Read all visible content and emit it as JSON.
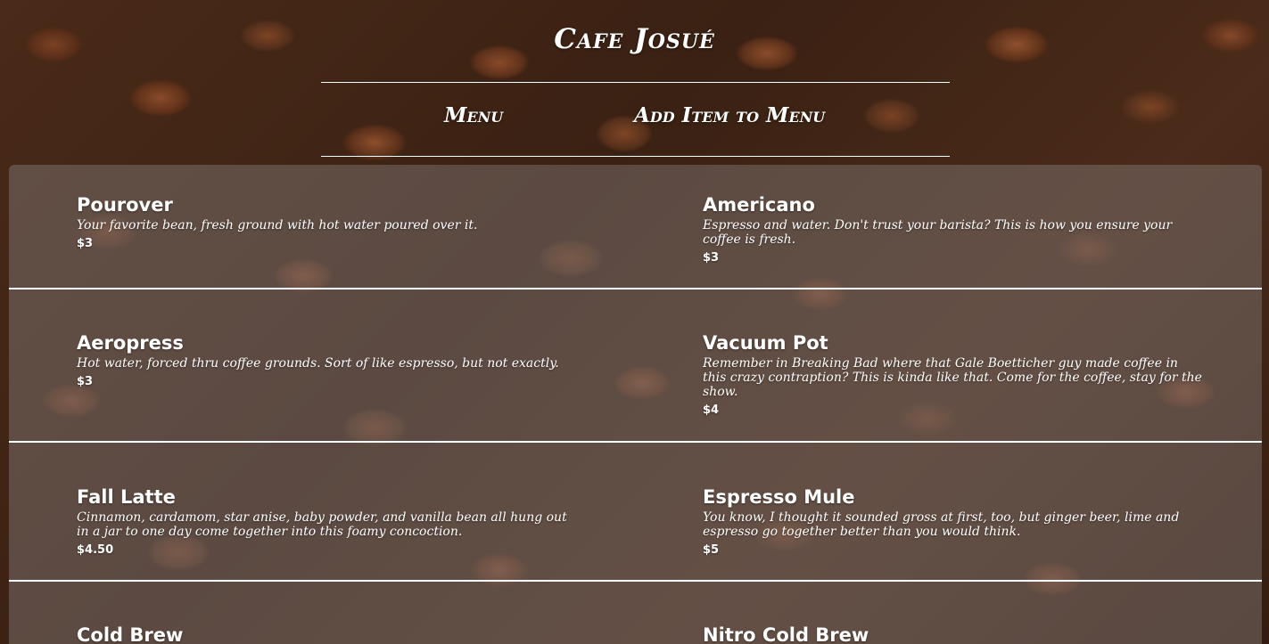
{
  "header": {
    "title": "Cafe Josué",
    "nav": {
      "menu": "Menu",
      "add_item": "Add Item to Menu"
    }
  },
  "menu": {
    "rows": [
      {
        "left": {
          "name": "Pourover",
          "description": "Your favorite bean, fresh ground with hot water poured over it.",
          "price": "$3"
        },
        "right": {
          "name": "Americano",
          "description": "Espresso and water. Don't trust your barista? This is how you ensure your coffee is fresh.",
          "price": "$3"
        }
      },
      {
        "left": {
          "name": "Aeropress",
          "description": "Hot water, forced thru coffee grounds. Sort of like espresso, but not exactly.",
          "price": "$3"
        },
        "right": {
          "name": "Vacuum Pot",
          "description": "Remember in Breaking Bad where that Gale Boetticher guy made coffee in this crazy contraption? This is kinda like that. Come for the coffee, stay for the show.",
          "price": "$4"
        }
      },
      {
        "left": {
          "name": "Fall Latte",
          "description": "Cinnamon, cardamom, star anise, baby powder, and vanilla bean all hung out in a jar to one day come together into this foamy concoction.",
          "price": "$4.50"
        },
        "right": {
          "name": "Espresso Mule",
          "description": "You know, I thought it sounded gross at first, too, but ginger beer, lime and espresso go together better than you would think.",
          "price": "$5"
        }
      },
      {
        "left": {
          "name": "Cold Brew"
        },
        "right": {
          "name": "Nitro Cold Brew"
        }
      }
    ]
  }
}
